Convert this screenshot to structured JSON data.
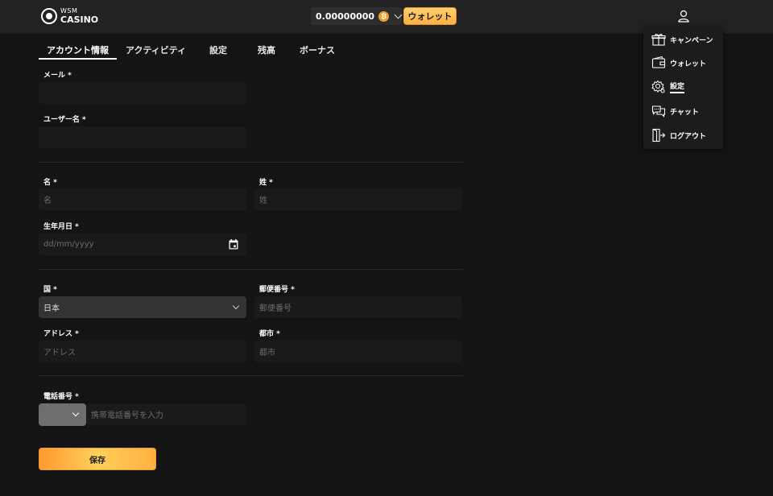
{
  "header": {
    "logo_top": "WSM",
    "logo_bottom": "CASINO",
    "balance": "0.00000000",
    "coin_symbol": "₿",
    "wallet_button": "ウォレット"
  },
  "user_menu": {
    "items": [
      {
        "label": "キャンペーン",
        "icon": "gift-icon"
      },
      {
        "label": "ウォレット",
        "icon": "wallet-icon"
      },
      {
        "label": "設定",
        "icon": "gear-icon",
        "active": true
      },
      {
        "label": "チャット",
        "icon": "chat-icon"
      },
      {
        "label": "ログアウト",
        "icon": "logout-icon"
      }
    ]
  },
  "tabs": [
    {
      "label": "アカウント情報",
      "active": true
    },
    {
      "label": "アクティビティ"
    },
    {
      "label": "設定"
    },
    {
      "label": "残高"
    },
    {
      "label": "ボーナス"
    }
  ],
  "form": {
    "email_label": "メール *",
    "email_value": "",
    "username_label": "ユーザー名 *",
    "username_value": "",
    "first_name_label": "名 *",
    "first_name_placeholder": "名",
    "last_name_label": "姓 *",
    "last_name_placeholder": "姓",
    "birthdate_label": "生年月日 *",
    "birthdate_placeholder": "dd/mm/yyyy",
    "country_label": "国 *",
    "country_value": "日本",
    "postal_label": "郵便番号 *",
    "postal_placeholder": "郵便番号",
    "address_label": "アドレス *",
    "address_placeholder": "アドレス",
    "city_label": "都市 *",
    "city_placeholder": "都市",
    "phone_label": "電話番号 *",
    "phone_placeholder": "携帯電話番号を入力",
    "save_button": "保存"
  },
  "colors": {
    "background": "#141414",
    "header": "#222222",
    "accent": "#ffb040",
    "input_bg": "#1a1a1a"
  }
}
